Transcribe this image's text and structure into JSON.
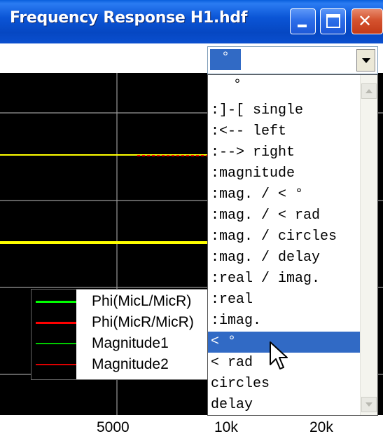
{
  "window": {
    "title": "Frequency Response H1.hdf",
    "controls": [
      "minimize",
      "maximize",
      "close"
    ]
  },
  "view_select": {
    "selected_value": "°",
    "options": [
      "°",
      ":]-[ single",
      ":<-- left",
      ":--> right",
      ":magnitude",
      ":mag. / < °",
      ":mag. / < rad",
      ":mag. / circles",
      ":mag. / delay",
      ":real / imag.",
      ":real",
      ":imag.",
      "< °",
      "< rad",
      "circles",
      "delay"
    ],
    "highlighted_index": 12
  },
  "legend": {
    "entries": [
      {
        "label": "Phi(MicL/MicR)",
        "color": "#00ff00"
      },
      {
        "label": "Phi(MicR/MicR)",
        "color": "#ff0000"
      },
      {
        "label": "Magnitude1",
        "color": "#00ff00"
      },
      {
        "label": "Magnitude2",
        "color": "#ff0000"
      }
    ]
  },
  "x_axis": {
    "ticks": [
      "5000",
      "10k",
      "20k"
    ]
  },
  "colors": {
    "plot_background": "#000000",
    "grid": "#9a9a9a",
    "trace_yellow": "#ffff00",
    "trace_red": "#ff0000",
    "selection": "#316ac5",
    "titlebar": "#0a4fcf"
  }
}
